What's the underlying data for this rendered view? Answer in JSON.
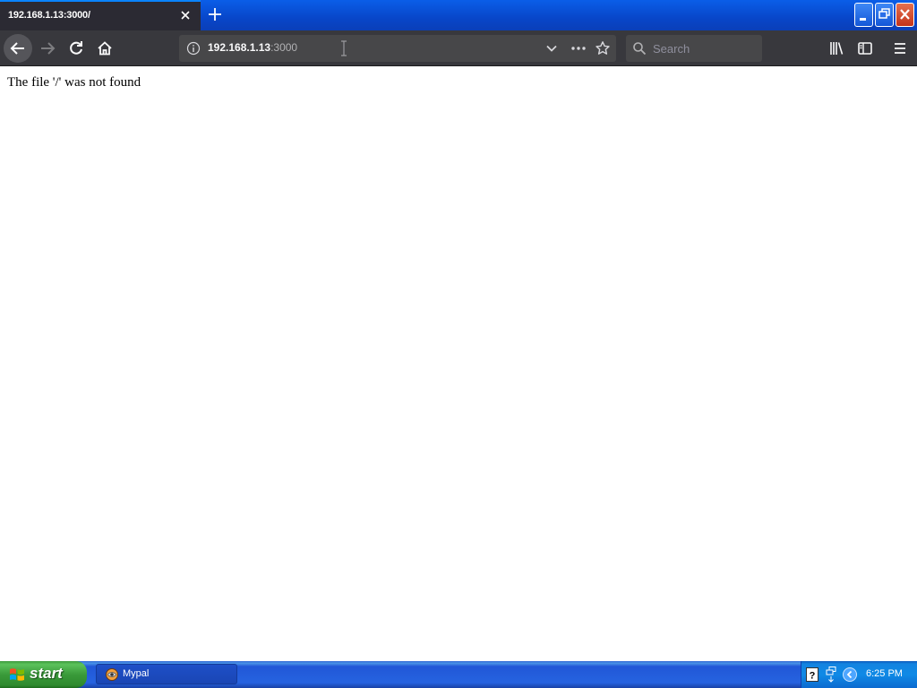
{
  "tab": {
    "title": "192.168.1.13:3000/"
  },
  "urlbar": {
    "host": "192.168.1.13",
    "port": ":3000"
  },
  "search": {
    "placeholder": "Search"
  },
  "page": {
    "message": "The file '/' was not found"
  },
  "taskbar": {
    "start_label": "start",
    "task_label": "Mypal",
    "clock": "6:25 PM"
  },
  "colors": {
    "toolbar": "#38383d",
    "tab_active": "#2b2a33",
    "taskbar_blue": "#2663e0",
    "start_green": "#3a9a3a"
  }
}
